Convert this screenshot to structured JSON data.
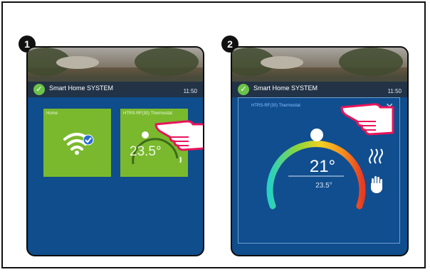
{
  "steps": [
    {
      "number": "1",
      "header": {
        "app_name": "Smart Home SYSTEM",
        "time": "11:50"
      },
      "tiles": [
        {
          "label": "Home",
          "icon": "wifi-icon"
        },
        {
          "label": "HTRS-RF(30) Thermostat",
          "temperature": "23.5°"
        }
      ]
    },
    {
      "number": "2",
      "header": {
        "app_name": "Smart Home SYSTEM",
        "time": "11:50"
      },
      "thermostat": {
        "title": "HTRS-RF(30) Thermostat",
        "set_temperature": "21°",
        "current_temperature": "23.5°"
      }
    }
  ],
  "colors": {
    "panel_bg": "#0f4d8c",
    "tile_green": "#7ab92e",
    "hand_pink": "#e8145b"
  }
}
